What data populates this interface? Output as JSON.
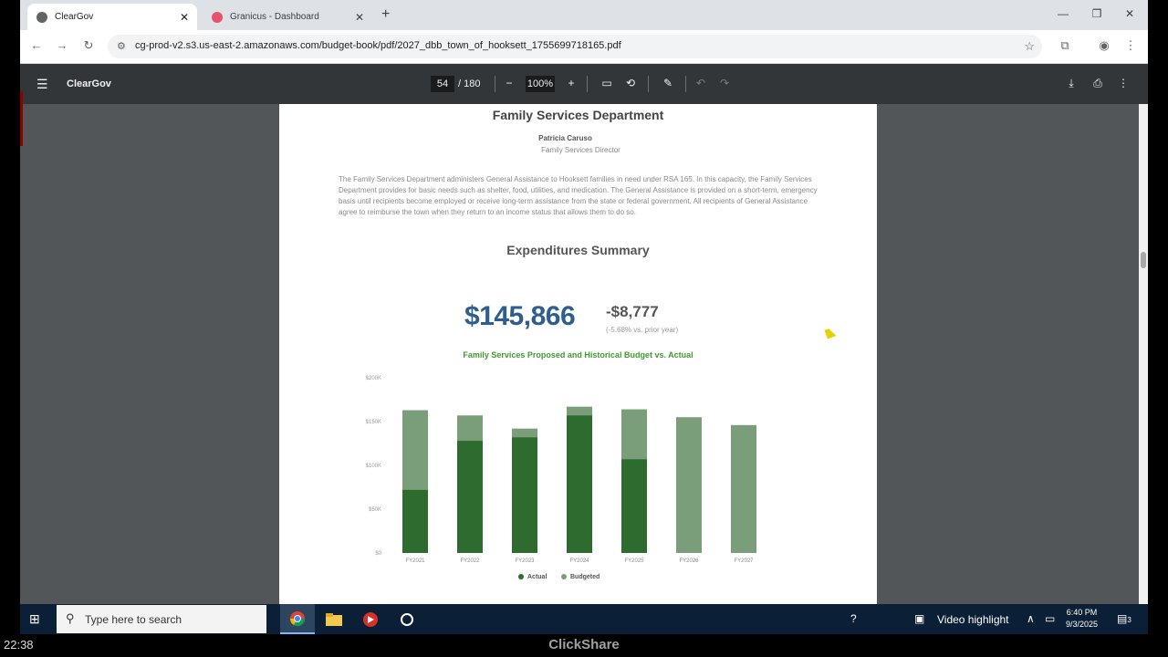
{
  "browser": {
    "tabs": [
      {
        "title": "ClearGov",
        "active": true
      },
      {
        "title": "Granicus - Dashboard",
        "active": false
      }
    ],
    "url": "cg-prod-v2.s3.us-east-2.amazonaws.com/budget-book/pdf/2027_dbb_town_of_hooksett_1755699718165.pdf"
  },
  "pdf_toolbar": {
    "title": "ClearGov",
    "page_current": "54",
    "page_total": "/ 180",
    "zoom": "100%"
  },
  "document": {
    "dept_title": "Family Services Department",
    "director_name": "Patricia Caruso",
    "director_role": "Family Services Director",
    "description": "The Family Services Department administers General Assistance to Hooksett families in need under RSA 165. In this capacity, the Family Services Department provides for basic needs such as shelter, food, utilities, and medication. The General Assistance is provided on a short-term, emergency basis until recipients become employed or receive long-term assistance from the state or federal government. All recipients of General Assistance agree to reimburse the town when they return to an income status that allows them to do so.",
    "summary_title": "Expenditures Summary",
    "total_amount": "$145,866",
    "change_amount": "-$8,777",
    "change_note": "(-5.68% vs. prior year)"
  },
  "chart_data": {
    "type": "bar",
    "title": "Family Services Proposed and Historical Budget vs. Actual",
    "categories": [
      "FY2021",
      "FY2022",
      "FY2023",
      "FY2024",
      "FY2025",
      "FY2026",
      "FY2027"
    ],
    "series": [
      {
        "name": "Actual",
        "values": [
          72000,
          128000,
          132000,
          157000,
          107000,
          null,
          null
        ],
        "color": "#2e6b2e"
      },
      {
        "name": "Budgeted",
        "values": [
          163000,
          157000,
          142000,
          167000,
          164000,
          155000,
          146000
        ],
        "color": "#7a9e7a"
      }
    ],
    "y_ticks": [
      "$0",
      "$50K",
      "$100K",
      "$150K",
      "$200K"
    ],
    "ylim": [
      0,
      200000
    ],
    "legend_position": "bottom"
  },
  "taskbar": {
    "search_placeholder": "Type here to search",
    "video_highlight": "Video highlight",
    "clock_time": "6:40 PM",
    "clock_date": "9/3/2025",
    "notif_count": "3"
  },
  "overlay": {
    "elapsed_time": "22:38",
    "brand": "ClickShare"
  }
}
